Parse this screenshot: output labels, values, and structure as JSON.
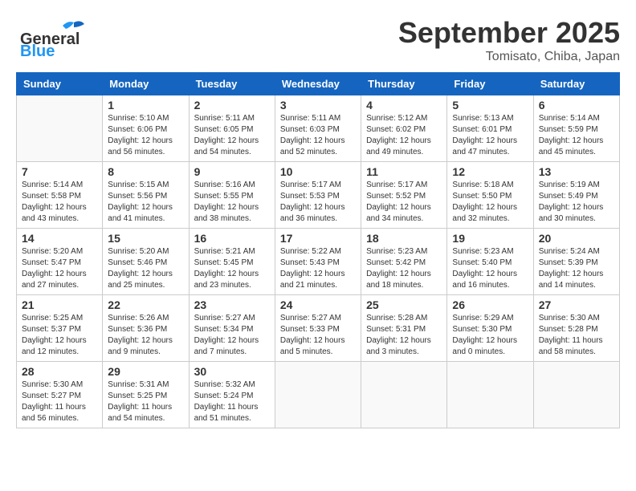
{
  "header": {
    "logo_general": "General",
    "logo_blue": "Blue",
    "month": "September 2025",
    "location": "Tomisato, Chiba, Japan"
  },
  "weekdays": [
    "Sunday",
    "Monday",
    "Tuesday",
    "Wednesday",
    "Thursday",
    "Friday",
    "Saturday"
  ],
  "weeks": [
    [
      {
        "day": "",
        "info": ""
      },
      {
        "day": "1",
        "info": "Sunrise: 5:10 AM\nSunset: 6:06 PM\nDaylight: 12 hours\nand 56 minutes."
      },
      {
        "day": "2",
        "info": "Sunrise: 5:11 AM\nSunset: 6:05 PM\nDaylight: 12 hours\nand 54 minutes."
      },
      {
        "day": "3",
        "info": "Sunrise: 5:11 AM\nSunset: 6:03 PM\nDaylight: 12 hours\nand 52 minutes."
      },
      {
        "day": "4",
        "info": "Sunrise: 5:12 AM\nSunset: 6:02 PM\nDaylight: 12 hours\nand 49 minutes."
      },
      {
        "day": "5",
        "info": "Sunrise: 5:13 AM\nSunset: 6:01 PM\nDaylight: 12 hours\nand 47 minutes."
      },
      {
        "day": "6",
        "info": "Sunrise: 5:14 AM\nSunset: 5:59 PM\nDaylight: 12 hours\nand 45 minutes."
      }
    ],
    [
      {
        "day": "7",
        "info": "Sunrise: 5:14 AM\nSunset: 5:58 PM\nDaylight: 12 hours\nand 43 minutes."
      },
      {
        "day": "8",
        "info": "Sunrise: 5:15 AM\nSunset: 5:56 PM\nDaylight: 12 hours\nand 41 minutes."
      },
      {
        "day": "9",
        "info": "Sunrise: 5:16 AM\nSunset: 5:55 PM\nDaylight: 12 hours\nand 38 minutes."
      },
      {
        "day": "10",
        "info": "Sunrise: 5:17 AM\nSunset: 5:53 PM\nDaylight: 12 hours\nand 36 minutes."
      },
      {
        "day": "11",
        "info": "Sunrise: 5:17 AM\nSunset: 5:52 PM\nDaylight: 12 hours\nand 34 minutes."
      },
      {
        "day": "12",
        "info": "Sunrise: 5:18 AM\nSunset: 5:50 PM\nDaylight: 12 hours\nand 32 minutes."
      },
      {
        "day": "13",
        "info": "Sunrise: 5:19 AM\nSunset: 5:49 PM\nDaylight: 12 hours\nand 30 minutes."
      }
    ],
    [
      {
        "day": "14",
        "info": "Sunrise: 5:20 AM\nSunset: 5:47 PM\nDaylight: 12 hours\nand 27 minutes."
      },
      {
        "day": "15",
        "info": "Sunrise: 5:20 AM\nSunset: 5:46 PM\nDaylight: 12 hours\nand 25 minutes."
      },
      {
        "day": "16",
        "info": "Sunrise: 5:21 AM\nSunset: 5:45 PM\nDaylight: 12 hours\nand 23 minutes."
      },
      {
        "day": "17",
        "info": "Sunrise: 5:22 AM\nSunset: 5:43 PM\nDaylight: 12 hours\nand 21 minutes."
      },
      {
        "day": "18",
        "info": "Sunrise: 5:23 AM\nSunset: 5:42 PM\nDaylight: 12 hours\nand 18 minutes."
      },
      {
        "day": "19",
        "info": "Sunrise: 5:23 AM\nSunset: 5:40 PM\nDaylight: 12 hours\nand 16 minutes."
      },
      {
        "day": "20",
        "info": "Sunrise: 5:24 AM\nSunset: 5:39 PM\nDaylight: 12 hours\nand 14 minutes."
      }
    ],
    [
      {
        "day": "21",
        "info": "Sunrise: 5:25 AM\nSunset: 5:37 PM\nDaylight: 12 hours\nand 12 minutes."
      },
      {
        "day": "22",
        "info": "Sunrise: 5:26 AM\nSunset: 5:36 PM\nDaylight: 12 hours\nand 9 minutes."
      },
      {
        "day": "23",
        "info": "Sunrise: 5:27 AM\nSunset: 5:34 PM\nDaylight: 12 hours\nand 7 minutes."
      },
      {
        "day": "24",
        "info": "Sunrise: 5:27 AM\nSunset: 5:33 PM\nDaylight: 12 hours\nand 5 minutes."
      },
      {
        "day": "25",
        "info": "Sunrise: 5:28 AM\nSunset: 5:31 PM\nDaylight: 12 hours\nand 3 minutes."
      },
      {
        "day": "26",
        "info": "Sunrise: 5:29 AM\nSunset: 5:30 PM\nDaylight: 12 hours\nand 0 minutes."
      },
      {
        "day": "27",
        "info": "Sunrise: 5:30 AM\nSunset: 5:28 PM\nDaylight: 11 hours\nand 58 minutes."
      }
    ],
    [
      {
        "day": "28",
        "info": "Sunrise: 5:30 AM\nSunset: 5:27 PM\nDaylight: 11 hours\nand 56 minutes."
      },
      {
        "day": "29",
        "info": "Sunrise: 5:31 AM\nSunset: 5:25 PM\nDaylight: 11 hours\nand 54 minutes."
      },
      {
        "day": "30",
        "info": "Sunrise: 5:32 AM\nSunset: 5:24 PM\nDaylight: 11 hours\nand 51 minutes."
      },
      {
        "day": "",
        "info": ""
      },
      {
        "day": "",
        "info": ""
      },
      {
        "day": "",
        "info": ""
      },
      {
        "day": "",
        "info": ""
      }
    ]
  ]
}
